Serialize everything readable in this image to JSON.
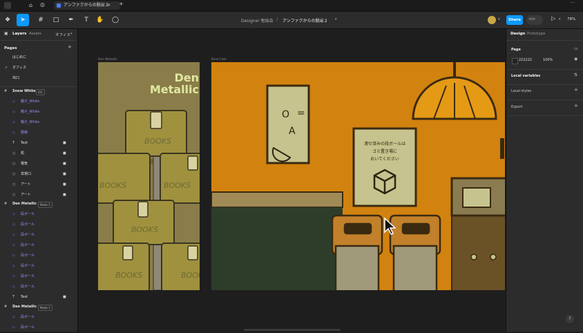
{
  "titlebar": {
    "tab_title": "アンファクからの脱出２",
    "close_glyph": "×",
    "add_glyph": "+",
    "more_glyph": "···"
  },
  "toolbar": {
    "project": "Designer 勉強会",
    "separator": "/",
    "file_name": "アンファクからの脱出２",
    "share_label": "Share",
    "zoom": "78%",
    "code_glyph": "</>"
  },
  "left_panel": {
    "tabs": [
      "Layers",
      "Assets"
    ],
    "page_select": "オフィス",
    "pages_title": "Pages",
    "pages": [
      "はじめに",
      "オフィス",
      "出口"
    ],
    "current_page": "オフィス",
    "frame1": {
      "name": "Snow White",
      "mode": "4月"
    },
    "frame1_layers": [
      {
        "label": "棚子_White",
        "lock": false,
        "icon": "component"
      },
      {
        "label": "棚子_White",
        "lock": false,
        "icon": "component"
      },
      {
        "label": "棚子_White",
        "lock": false,
        "icon": "component"
      },
      {
        "label": "額縁",
        "lock": false,
        "icon": "component"
      },
      {
        "label": "Text",
        "lock": true,
        "icon": "text"
      },
      {
        "label": "机",
        "lock": true,
        "icon": "frame"
      },
      {
        "label": "電気",
        "lock": true,
        "icon": "frame"
      },
      {
        "label": "非常口",
        "lock": true,
        "icon": "frame"
      },
      {
        "label": "アート",
        "lock": true,
        "icon": "frame"
      },
      {
        "label": "アート",
        "lock": true,
        "icon": "frame"
      }
    ],
    "frame2": {
      "name": "Den Metallic",
      "mode": "Mode 1"
    },
    "frame2_layers": [
      {
        "label": "段ボール",
        "lock": false,
        "icon": "component"
      },
      {
        "label": "段ボール",
        "lock": false,
        "icon": "component"
      },
      {
        "label": "段ボール",
        "lock": false,
        "icon": "component"
      },
      {
        "label": "段ボール",
        "lock": false,
        "icon": "component"
      },
      {
        "label": "段ボール",
        "lock": false,
        "icon": "component"
      },
      {
        "label": "段ボール",
        "lock": false,
        "icon": "component"
      },
      {
        "label": "段ボール",
        "lock": false,
        "icon": "component"
      },
      {
        "label": "段ボール",
        "lock": false,
        "icon": "component"
      },
      {
        "label": "Text",
        "lock": true,
        "icon": "text"
      }
    ],
    "frame3": {
      "name": "Den Metallic",
      "mode": "Mode 1"
    },
    "frame3_layers": [
      {
        "label": "段ボール",
        "lock": false,
        "icon": "component"
      },
      {
        "label": "段ボール",
        "lock": false,
        "icon": "component"
      }
    ]
  },
  "right_panel": {
    "tabs": [
      "Design",
      "Prototype"
    ],
    "page_label": "Page",
    "page_color": "222222",
    "page_opacity": "100%",
    "sections": [
      "Local variables",
      "Local styles",
      "Export"
    ]
  },
  "canvas": {
    "frame_label_1": "Den Metallic",
    "frame_label_2": "Kind Cafe",
    "den_title_line1": "Den",
    "den_title_line2": "Metallic",
    "box_text": "BOOKS",
    "poster_glyph_1": "O",
    "poster_glyph_2": "=",
    "poster_glyph_3": "A",
    "notice_line1": "潰せ済みの段ボールは",
    "notice_line2": "ゴミ置き場に",
    "notice_line3": "おいてください",
    "help": "?"
  }
}
